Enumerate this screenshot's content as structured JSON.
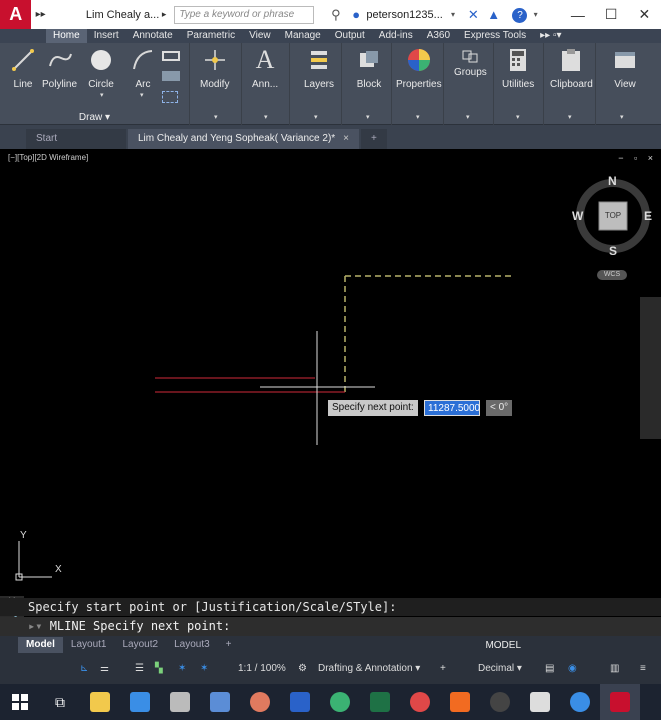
{
  "app": {
    "logo_letter": "A",
    "document_title": "Lim Chealy a...",
    "search_placeholder": "Type a keyword or phrase",
    "user": "peterson1235...",
    "help": "?"
  },
  "ribbon_tabs": [
    "Home",
    "Insert",
    "Annotate",
    "Parametric",
    "View",
    "Manage",
    "Output",
    "Add-ins",
    "A360",
    "Express Tools"
  ],
  "ribbon": {
    "draw_tools": [
      "Line",
      "Polyline",
      "Circle",
      "Arc"
    ],
    "draw_panel_label": "Draw",
    "tools": [
      "Modify",
      "Ann...",
      "Layers",
      "Block",
      "Properties",
      "Groups",
      "Utilities",
      "Clipboard",
      "View"
    ]
  },
  "file_tabs": {
    "start": "Start",
    "active": "Lim Chealy and Yeng Sopheak( Variance 2)*",
    "close": "×",
    "add": "+"
  },
  "viewport": {
    "label": "[−][Top][2D Wireframe]",
    "controls": "− ▫ ×"
  },
  "viewcube": {
    "north": "N",
    "south": "S",
    "east": "E",
    "west": "W",
    "face": "TOP",
    "wcs": "WCS"
  },
  "ucs": {
    "x": "X",
    "y": "Y"
  },
  "dynamic_input": {
    "prompt": "Specify next point:",
    "distance": "11287.5000",
    "angle": "< 0°"
  },
  "command": {
    "history": "Specify start point or [Justification/Scale/STyle]:",
    "current": "MLINE Specify next point:"
  },
  "layout_tabs": [
    "Model",
    "Layout1",
    "Layout2",
    "Layout3"
  ],
  "status": {
    "model": "MODEL",
    "scale": "1:1 / 100%",
    "workspace": "Drafting & Annotation",
    "units": "Decimal"
  },
  "colors": {
    "ribbon_bg": "#464e5b",
    "tabs_bg": "#3b4453",
    "canvas_bg": "#000000",
    "mline_red": "#d02a3a",
    "dashed_guide": "#b8b36a",
    "autocad_red": "#c8102e"
  }
}
